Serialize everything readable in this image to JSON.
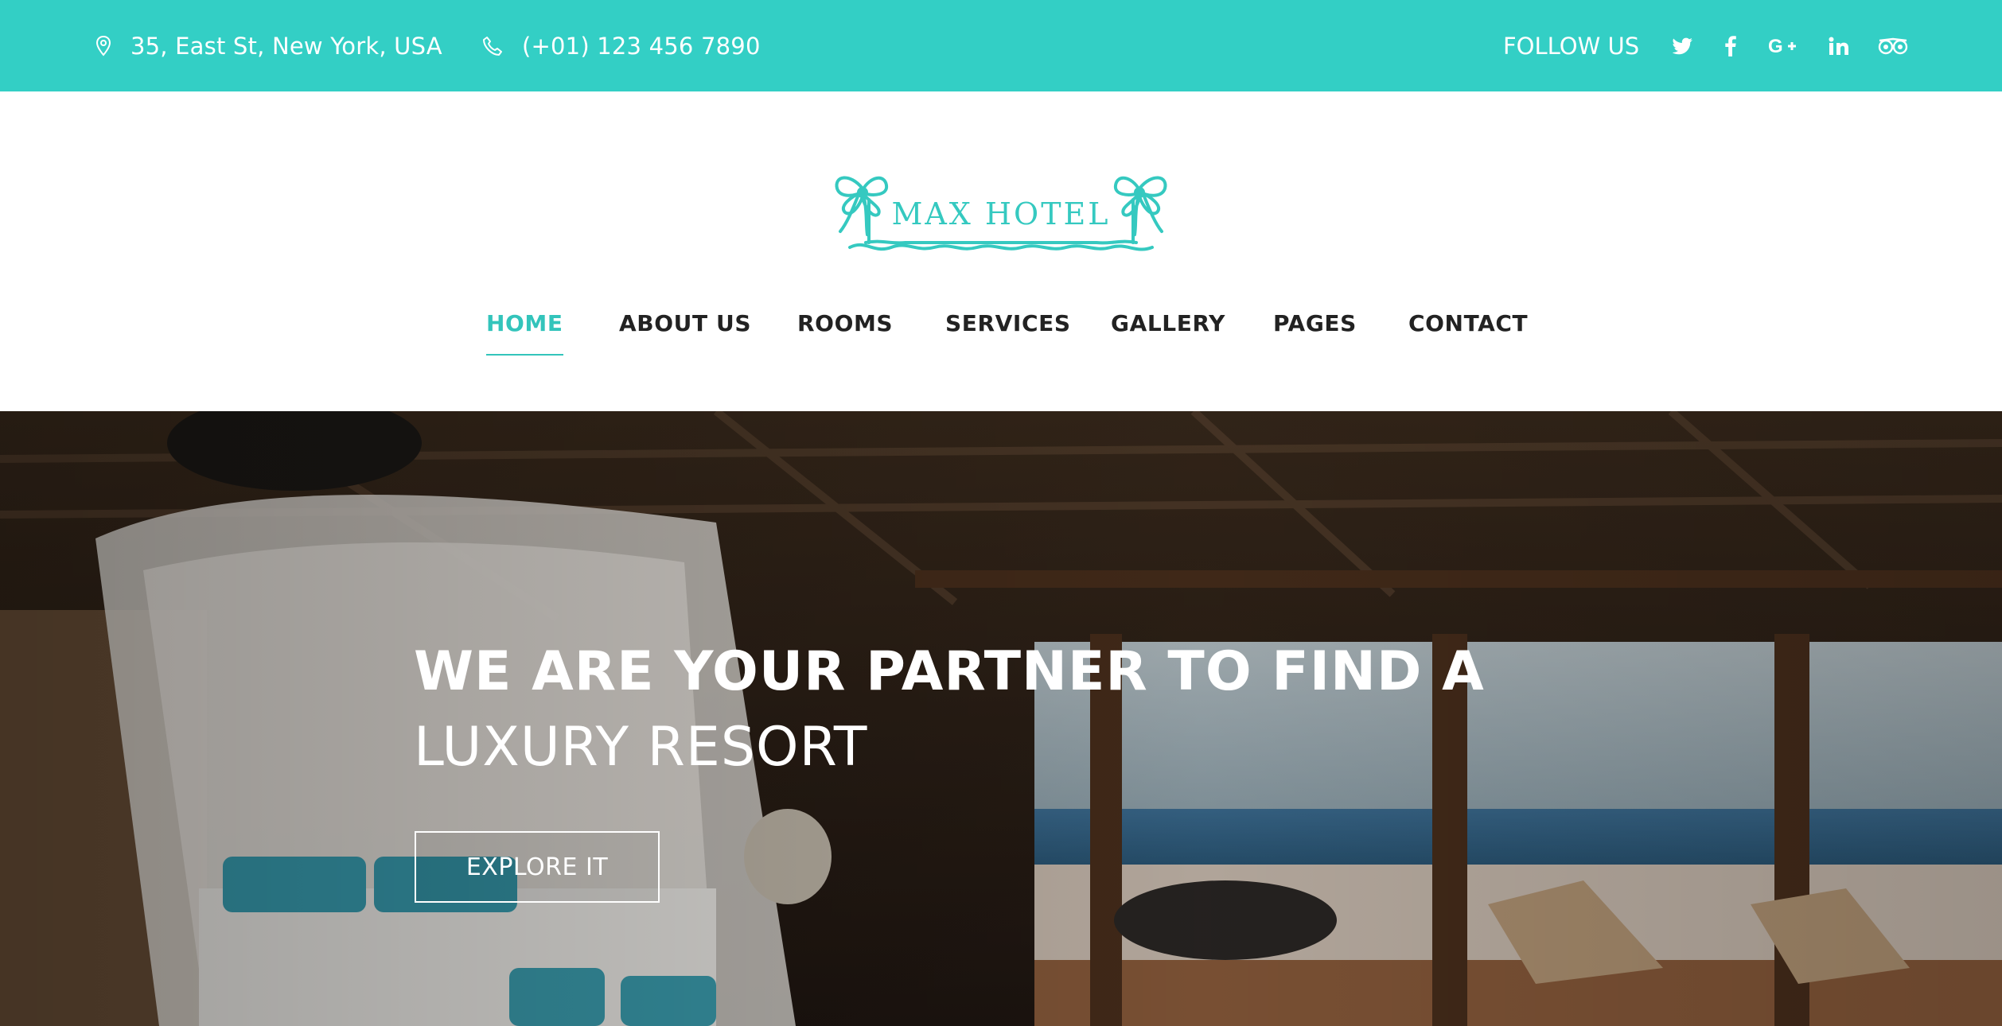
{
  "topbar": {
    "address": "35, East St, New York, USA",
    "phone": "(+01) 123 456 7890",
    "follow_label": "FOLLOW US",
    "social_icons": [
      "twitter-icon",
      "facebook-icon",
      "google-plus-icon",
      "linkedin-icon",
      "tripadvisor-icon"
    ]
  },
  "logo": {
    "text": "MAX HOTEL"
  },
  "nav": {
    "items": [
      {
        "label": "HOME",
        "active": true
      },
      {
        "label": "ABOUT US"
      },
      {
        "label": "ROOMS"
      },
      {
        "label": "SERVICES"
      },
      {
        "label": "GALLERY"
      },
      {
        "label": "PAGES"
      },
      {
        "label": "CONTACT"
      }
    ]
  },
  "hero": {
    "title_line1": "WE ARE YOUR PARTNER TO FIND A",
    "title_line2": "LUXURY RESORT",
    "button_label": "EXPLORE IT"
  },
  "colors": {
    "accent": "#33cfc5",
    "nav_text": "#222222",
    "white": "#ffffff"
  }
}
